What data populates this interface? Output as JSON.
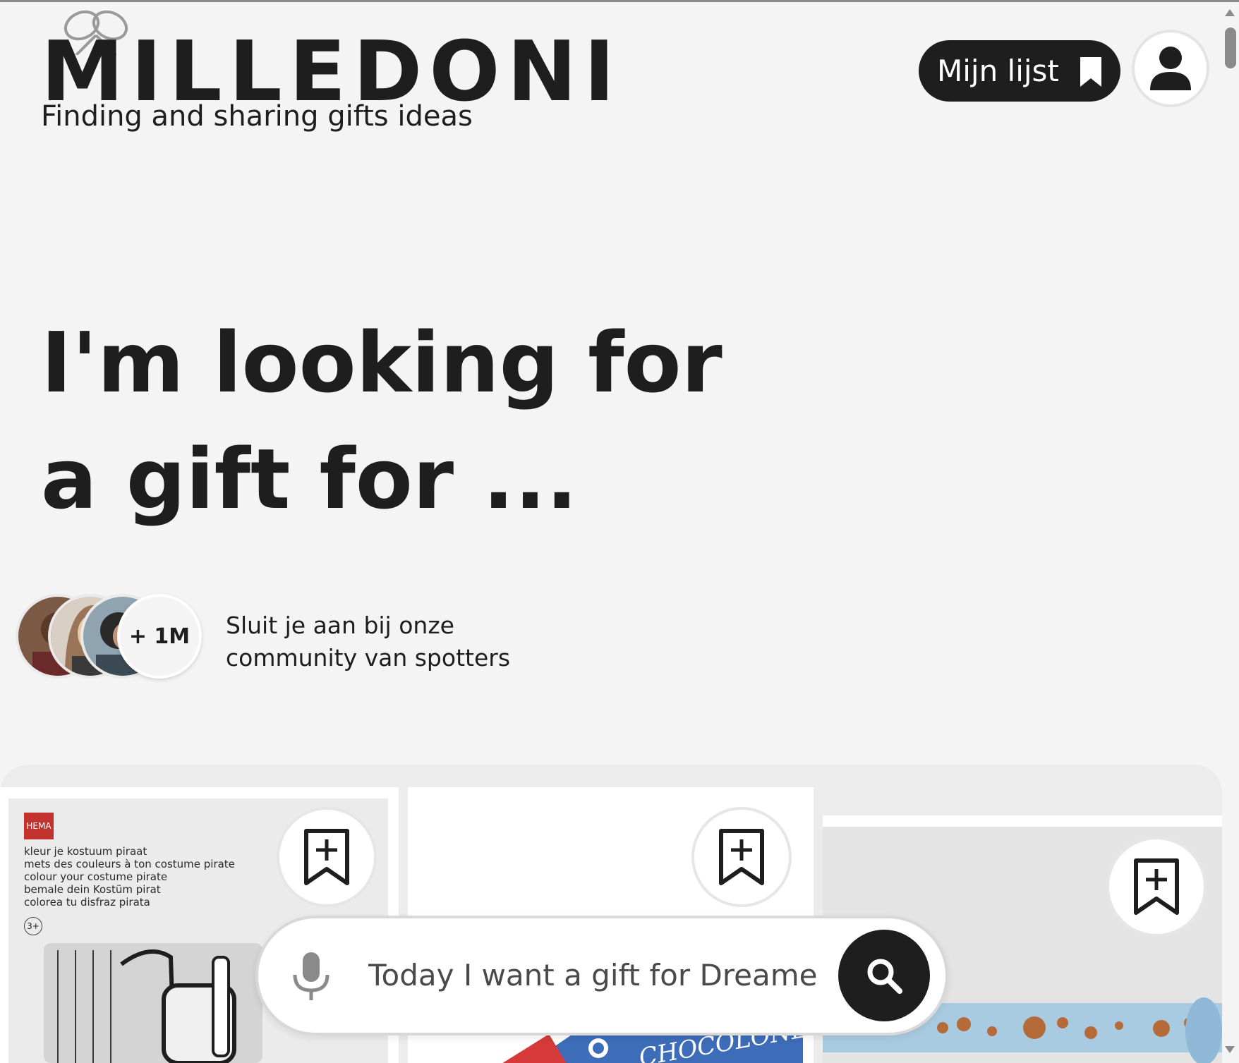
{
  "brand": {
    "name": "MILLEDONI",
    "tagline": "Finding and sharing gifts ideas",
    "text_color": "#1e1e1e"
  },
  "header": {
    "my_list_label": "Mijn lijst",
    "my_list_icon": "bookmark-icon",
    "user_icon": "user-icon"
  },
  "hero": {
    "line1": "I'm looking for",
    "line2": "a gift for ..."
  },
  "community": {
    "count_label": "+ 1M",
    "text_line1": "Sluit je aan bij onze",
    "text_line2": "community van spotters"
  },
  "products": [
    {
      "brand_badge": "HEMA",
      "lines": [
        "kleur je kostuum piraat",
        "mets des couleurs à ton costume pirate",
        "colour your costume pirate",
        "bemale dein Kostüm pirat",
        "colorea tu disfraz pirata"
      ],
      "age": "3+",
      "save_icon": "bookmark-plus-icon"
    },
    {
      "package_text": "CHOCOLONELY",
      "save_icon": "bookmark-plus-icon"
    },
    {
      "save_icon": "bookmark-plus-icon"
    }
  ],
  "search": {
    "placeholder": "Today I want a gift for Dreamers",
    "mic_icon": "microphone-icon",
    "search_icon": "search-icon"
  }
}
